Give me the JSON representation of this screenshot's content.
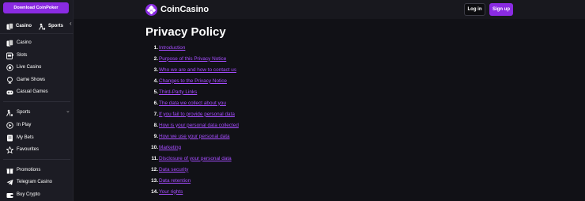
{
  "sidebar": {
    "download_label": "Download CoinPoker",
    "modes": [
      {
        "label": "Casino",
        "icon": "cards-icon"
      },
      {
        "label": "Sports",
        "icon": "sports-icon"
      }
    ],
    "collapse_icon": "chevron-left-icon",
    "casino_items": [
      {
        "label": "Casino",
        "icon": "cards-icon"
      },
      {
        "label": "Slots",
        "icon": "slot-machine-icon"
      },
      {
        "label": "Live Casino",
        "icon": "live-casino-icon"
      },
      {
        "label": "Game Shows",
        "icon": "game-shows-icon"
      },
      {
        "label": "Casual Games",
        "icon": "casual-games-icon"
      }
    ],
    "sports_items": [
      {
        "label": "Sports",
        "icon": "sports-icon"
      },
      {
        "label": "In Play",
        "icon": "play-icon"
      },
      {
        "label": "My Bets",
        "icon": "bets-icon"
      },
      {
        "label": "Favourites",
        "icon": "star-icon"
      }
    ],
    "extra_items": [
      {
        "label": "Promotions",
        "icon": "gift-icon"
      },
      {
        "label": "Telegram Casino",
        "icon": "telegram-icon"
      },
      {
        "label": "Buy Crypto",
        "icon": "wallet-icon"
      }
    ]
  },
  "header": {
    "brand": "CoinCasino",
    "login_label": "Log in",
    "signup_label": "Sign up"
  },
  "main": {
    "title": "Privacy Policy",
    "toc": [
      {
        "num": "1.",
        "label": "Introduction"
      },
      {
        "num": "2.",
        "label": "Purpose of this Privacy Notice"
      },
      {
        "num": "3.",
        "label": "Who we are and how to contact us"
      },
      {
        "num": "4.",
        "label": "Changes to the Privacy Notice"
      },
      {
        "num": "5.",
        "label": "Third-Party Links"
      },
      {
        "num": "6.",
        "label": "The data we collect about you"
      },
      {
        "num": "7.",
        "label": "If you fail to provide personal data"
      },
      {
        "num": "8.",
        "label": "How is your personal data collected"
      },
      {
        "num": "9.",
        "label": "How we use your personal data"
      },
      {
        "num": "10.",
        "label": "Marketing"
      },
      {
        "num": "11.",
        "label": "Disclosure of your personal data"
      },
      {
        "num": "12.",
        "label": "Data security"
      },
      {
        "num": "13.",
        "label": "Data retention"
      },
      {
        "num": "14.",
        "label": "Your rights"
      }
    ]
  },
  "colors": {
    "accent": "#8a2be2",
    "link": "#a64dff",
    "background": "#111116",
    "sidebar": "#1c1c24"
  }
}
